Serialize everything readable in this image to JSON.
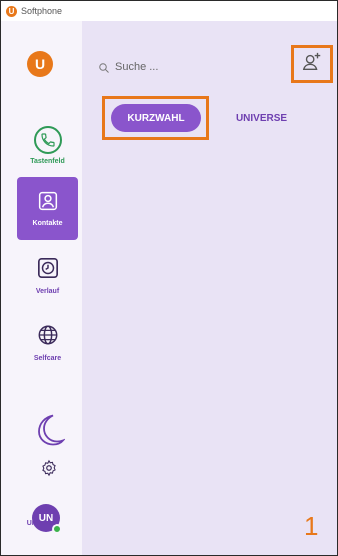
{
  "window": {
    "title": "Softphone",
    "app_icon_letter": "U"
  },
  "sidebar": {
    "logo_letter": "U",
    "items": [
      {
        "label": "Tastenfeld",
        "icon": "phone-icon"
      },
      {
        "label": "Kontakte",
        "icon": "contact-icon",
        "active": true
      },
      {
        "label": "Verlauf",
        "icon": "clock-icon"
      },
      {
        "label": "Selfcare",
        "icon": "globe-icon"
      }
    ],
    "theme_icon": "moon-icon",
    "settings_icon": "gear-icon",
    "user": {
      "initials": "UN",
      "label": "Universe",
      "status_color": "#3bb24a"
    }
  },
  "main": {
    "search": {
      "placeholder": "Suche ..."
    },
    "add_contact_icon": "add-contact-icon",
    "tabs": [
      {
        "label": "KURZWAHL",
        "active": true
      },
      {
        "label": "UNIVERSE",
        "active": false
      }
    ]
  },
  "annotation": {
    "number": "1"
  },
  "colors": {
    "accent": "#8a55cc",
    "highlight": "#e8781a",
    "main_bg": "#e9e3f5",
    "sidebar_bg": "#f7f4fb",
    "green": "#2f9a57"
  }
}
